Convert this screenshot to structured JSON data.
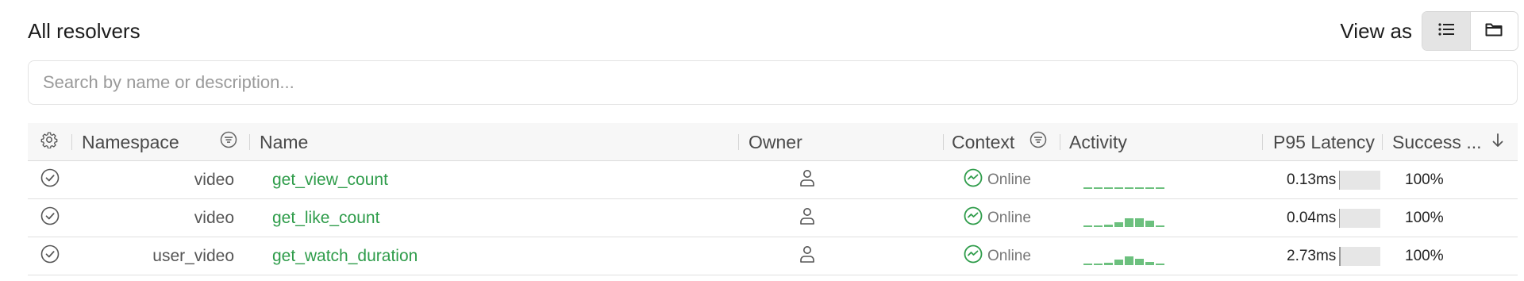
{
  "header": {
    "title": "All resolvers",
    "view_as_label": "View as",
    "view_options": [
      {
        "icon": "list-icon",
        "active": true
      },
      {
        "icon": "folder-icon",
        "active": false
      }
    ]
  },
  "search": {
    "placeholder": "Search by name or description...",
    "value": ""
  },
  "table": {
    "columns": {
      "settings_icon": "gear-icon",
      "namespace": "Namespace",
      "name": "Name",
      "owner": "Owner",
      "context": "Context",
      "activity": "Activity",
      "p95_latency": "P95 Latency",
      "success": "Success ...",
      "sort_icon": "arrow-down-icon",
      "filter_icon": "filter-icon"
    },
    "rows": [
      {
        "status_icon": "check-circle-icon",
        "namespace": "video",
        "name": "get_view_count",
        "owner_icon": "user-icon",
        "context": "Online",
        "activity": [
          1,
          1,
          1,
          1,
          1,
          1,
          1,
          1
        ],
        "p95_latency": "0.13ms",
        "latency_fraction": 0.02,
        "success": "100%"
      },
      {
        "status_icon": "check-circle-icon",
        "namespace": "video",
        "name": "get_like_count",
        "owner_icon": "user-icon",
        "context": "Online",
        "activity": [
          1,
          1,
          2,
          4,
          8,
          8,
          6,
          1
        ],
        "p95_latency": "0.04ms",
        "latency_fraction": 0.01,
        "success": "100%"
      },
      {
        "status_icon": "check-circle-icon",
        "namespace": "user_video",
        "name": "get_watch_duration",
        "owner_icon": "user-icon",
        "context": "Online",
        "activity": [
          1,
          1,
          2,
          5,
          8,
          6,
          3,
          1
        ],
        "p95_latency": "2.73ms",
        "latency_fraction": 0.03,
        "success": "100%"
      }
    ]
  },
  "colors": {
    "accent_green": "#2e9c4a",
    "activity_green": "#6cc07e",
    "border": "#e0e0e0"
  }
}
